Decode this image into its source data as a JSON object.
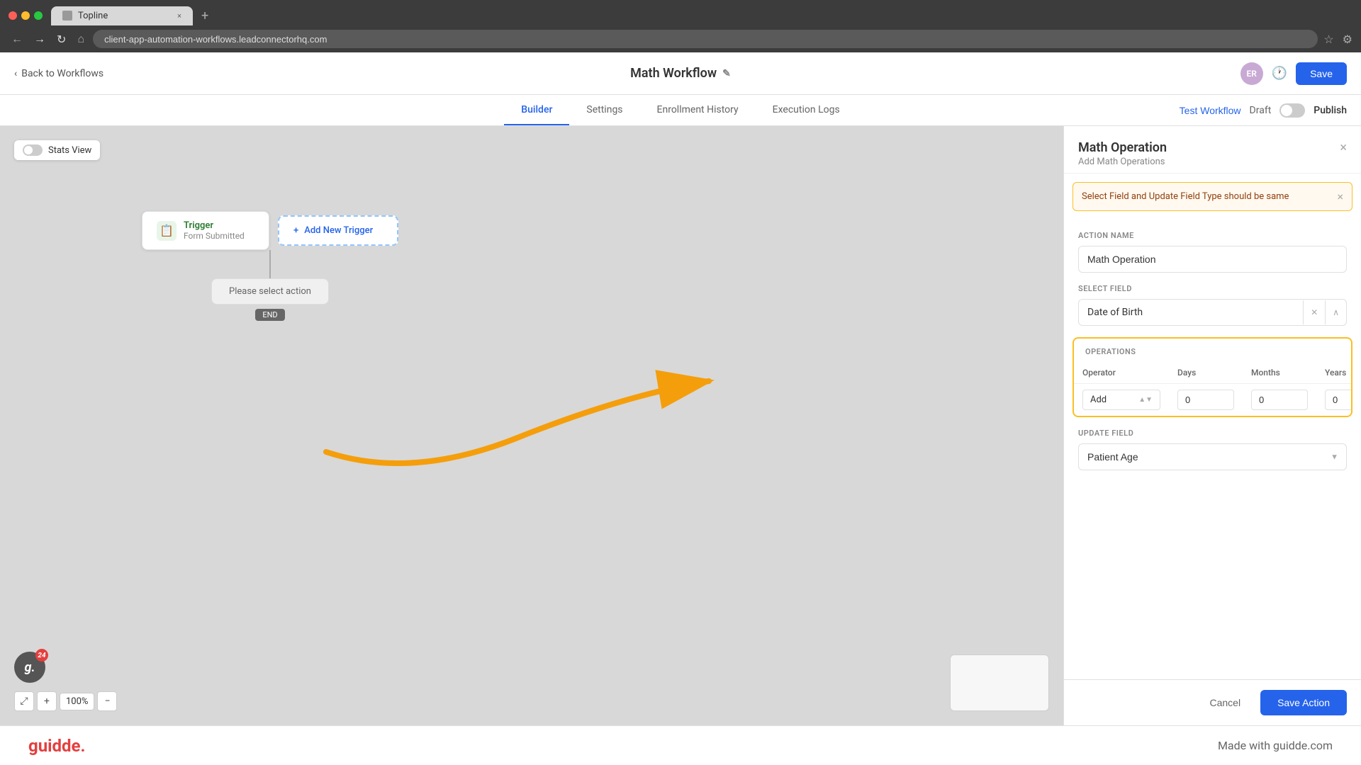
{
  "browser": {
    "tab_favicon": "T",
    "tab_title": "Topline",
    "tab_close": "×",
    "tab_new": "+",
    "url": "client-app-automation-workflows.leadconnectorhq.com",
    "nav_back": "←",
    "nav_forward": "→",
    "nav_refresh": "↻",
    "nav_home": "⌂"
  },
  "header": {
    "back_label": "Back to Workflows",
    "workflow_title": "Math Workflow",
    "edit_icon": "✎",
    "avatar_initials": "ER",
    "save_label": "Save"
  },
  "tabs": {
    "items": [
      "Builder",
      "Settings",
      "Enrollment History",
      "Execution Logs"
    ],
    "active": "Builder",
    "test_workflow": "Test Workflow",
    "draft": "Draft",
    "publish": "Publish"
  },
  "canvas": {
    "stats_view": "Stats View",
    "trigger_label": "Trigger",
    "trigger_sublabel": "Form Submitted",
    "add_trigger": "Add New Trigger",
    "action_placeholder": "Please select action",
    "end_badge": "END",
    "zoom_level": "100%"
  },
  "panel": {
    "title": "Math Operation",
    "subtitle": "Add Math Operations",
    "close_icon": "×",
    "error_message": "Select Field and Update Field Type should be same",
    "error_close": "×",
    "action_name_label": "ACTION NAME",
    "action_name_value": "Math Operation",
    "select_field_label": "SELECT FIELD",
    "select_field_value": "Date of Birth",
    "operations_label": "OPERATIONS",
    "op_header_operator": "Operator",
    "op_header_days": "Days",
    "op_header_months": "Months",
    "op_header_years": "Years",
    "op_operator_value": "Add",
    "op_days_value": "0",
    "op_months_value": "0",
    "op_years_value": "0",
    "update_field_label": "UPDATE FIELD",
    "update_field_value": "Patient Age",
    "cancel_label": "Cancel",
    "save_action_label": "Save Action"
  },
  "footer": {
    "logo": "guidde.",
    "tagline": "Made with guidde.com"
  }
}
